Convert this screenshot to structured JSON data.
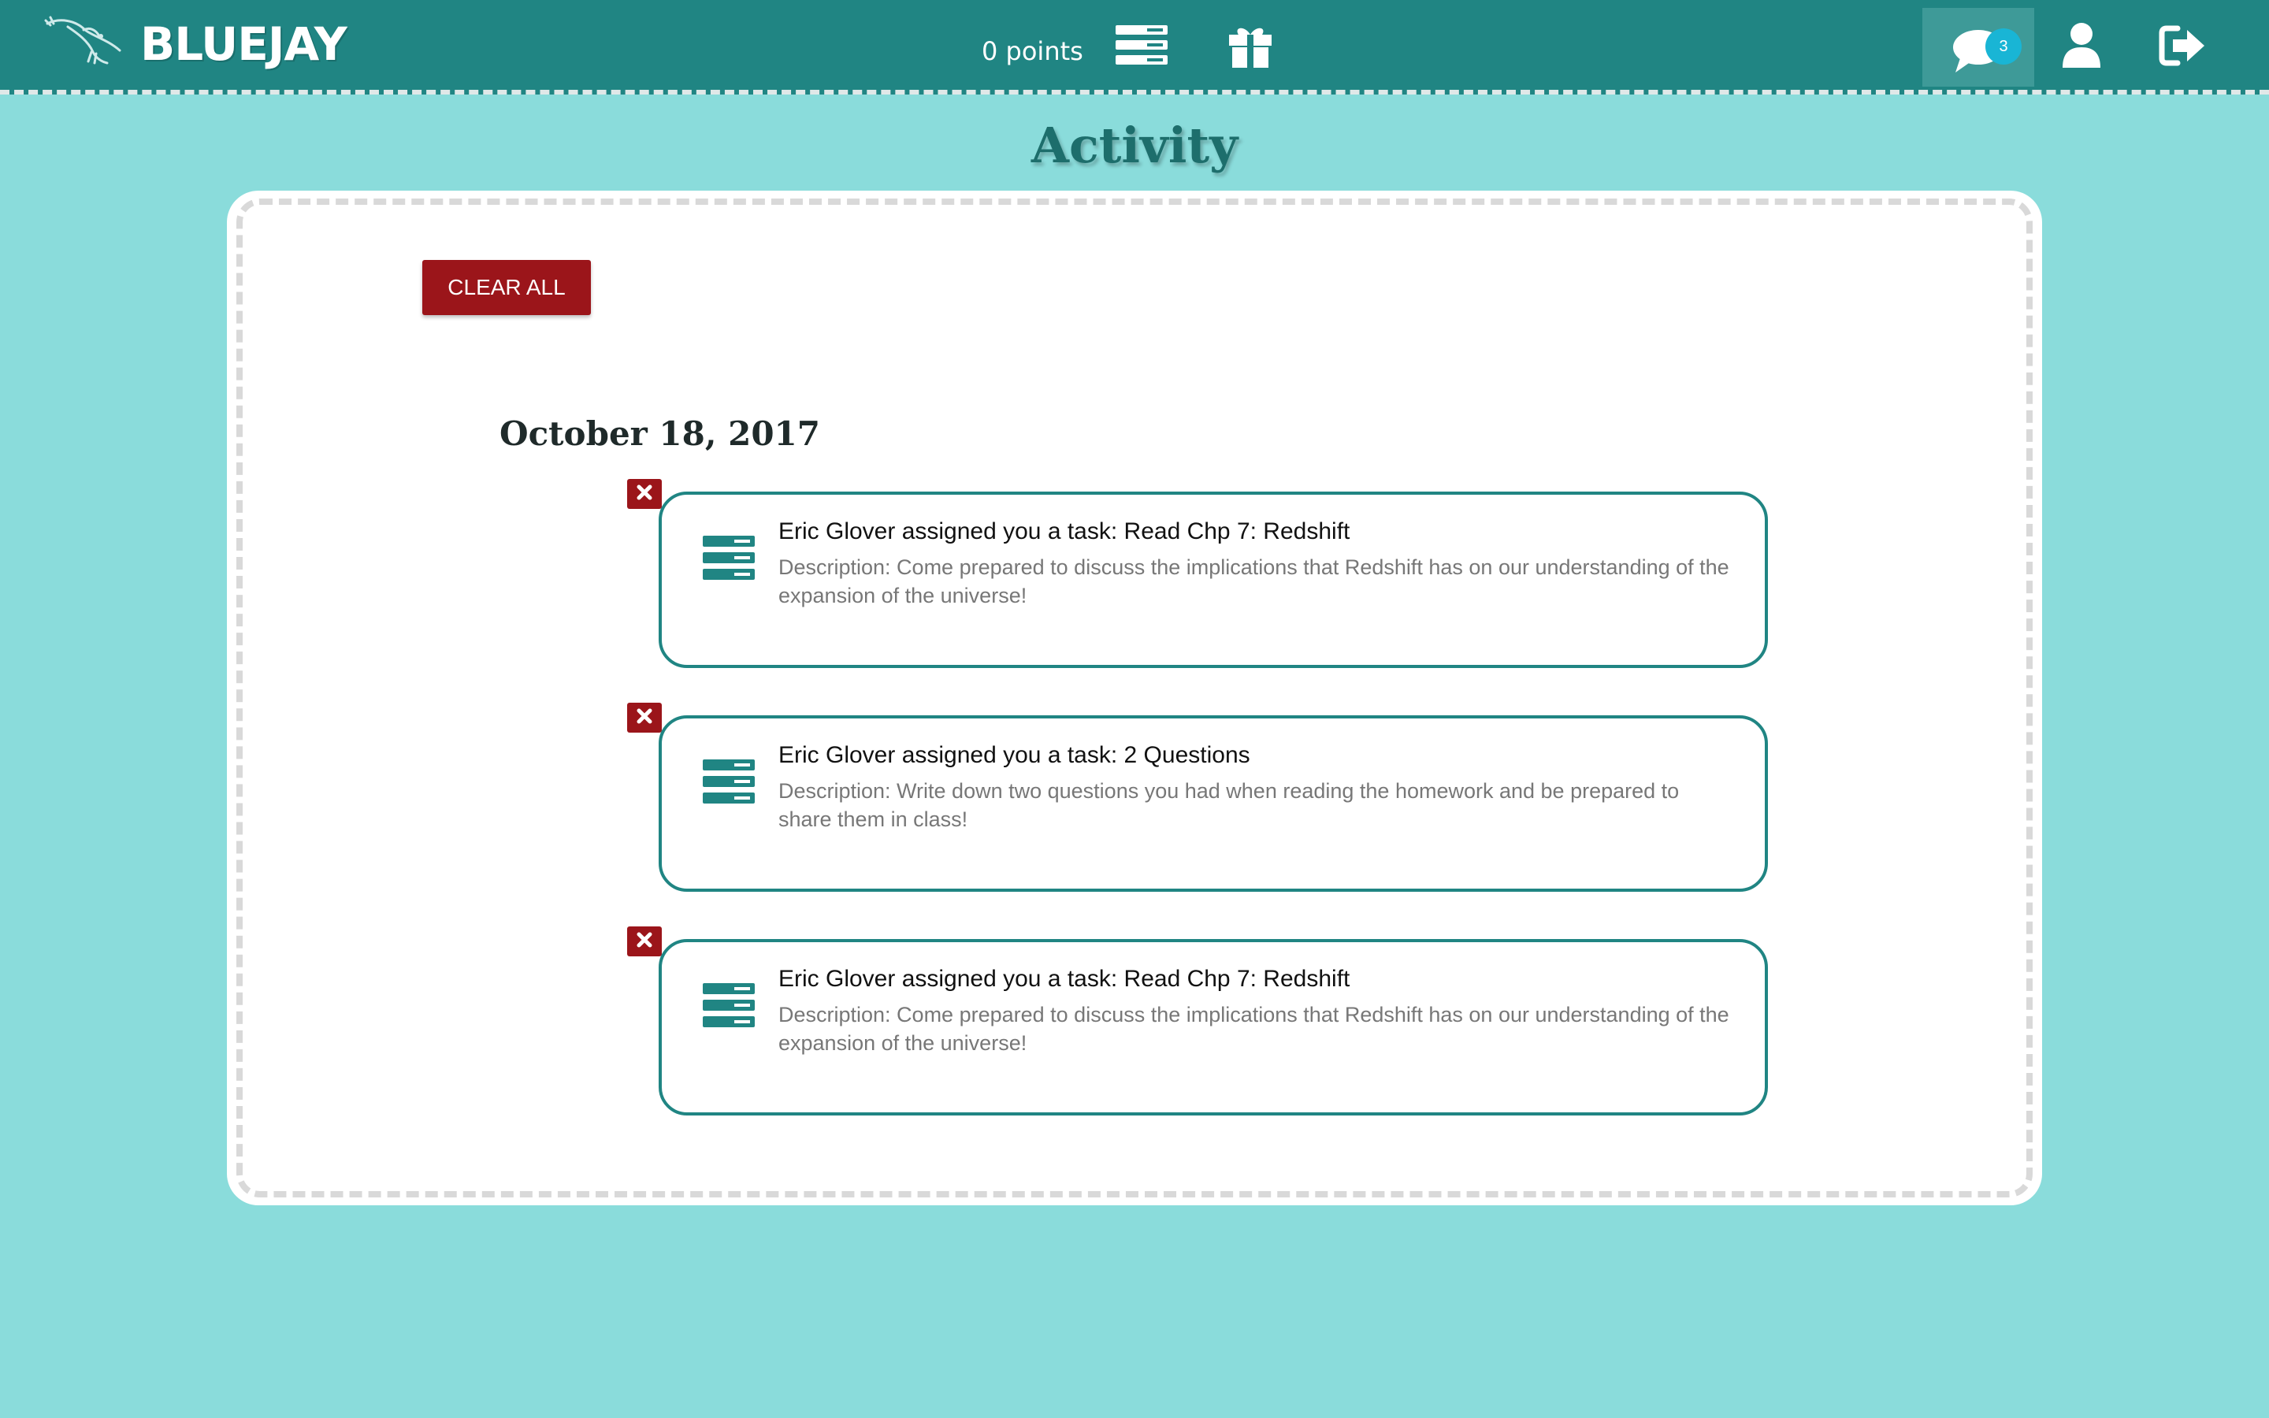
{
  "header": {
    "brand": "BLUEJAY",
    "points": "0 points",
    "message_count": "3",
    "icons": [
      "bird-logo-icon",
      "tasks-icon",
      "gift-icon",
      "chat-icon",
      "user-icon",
      "logout-icon"
    ]
  },
  "page": {
    "title": "Activity",
    "clear_all_label": "CLEAR ALL"
  },
  "groups": [
    {
      "date": "October 18, 2017",
      "items": [
        {
          "title": "Eric Glover assigned you a task: Read Chp 7: Redshift",
          "description": "Description: Come prepared to discuss the implications that Redshift has on our understanding of the expansion of the universe!"
        },
        {
          "title": "Eric Glover assigned you a task: 2 Questions",
          "description": "Description: Write down two questions you had when reading the homework and be prepared to share them in class!"
        },
        {
          "title": "Eric Glover assigned you a task: Read Chp 7: Redshift",
          "description": "Description: Come prepared to discuss the implications that Redshift has on our understanding of the expansion of the universe!"
        }
      ]
    }
  ],
  "colors": {
    "header_bg": "#208583",
    "page_bg": "#8adcdb",
    "accent_red": "#9b151a",
    "badge": "#19b5d5"
  }
}
